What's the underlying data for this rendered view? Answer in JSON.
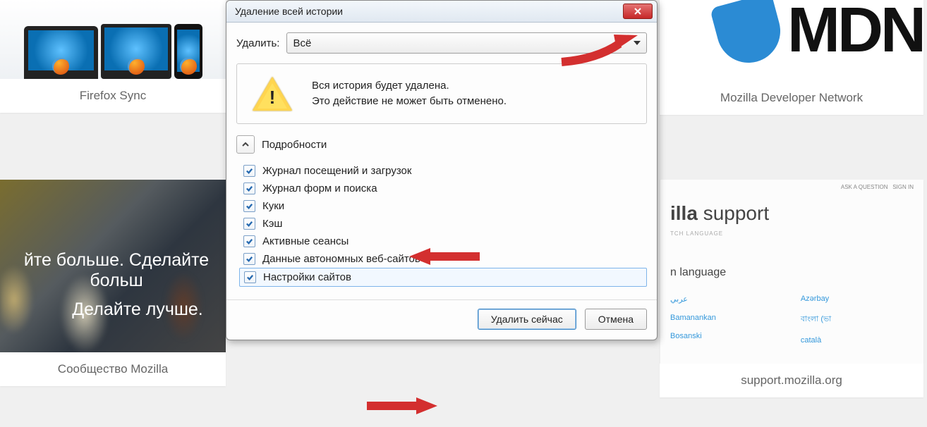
{
  "background": {
    "tile1_label": "Firefox Sync",
    "tile2_label": "Mozilla Developer Network",
    "tile3_label": "Сообщество Mozilla",
    "tile4_label": "support.mozilla.org",
    "crowd_line1": "йте больше. Сделайте больш",
    "crowd_line2": "Делайте лучше.",
    "support_title_bold": "illa",
    "support_title_rest": " support",
    "switch_lang": "n language",
    "lang1": "عربي",
    "lang1_r": "Azərbay",
    "lang2": "Bamanankan",
    "lang2_r": "বাংলা (ভা",
    "lang3": "Bosanski",
    "lang3_r": "català",
    "mdn_text": "MDN",
    "top_nav1": "ASK A QUESTION",
    "top_nav2": "SIGN IN"
  },
  "dialog": {
    "title": "Удаление всей истории",
    "delete_label": "Удалить:",
    "delete_value": "Всё",
    "warning_line1": "Вся история будет удалена.",
    "warning_line2": "Это действие не может быть отменено.",
    "details_label": "Подробности",
    "checks": [
      "Журнал посещений и загрузок",
      "Журнал форм и поиска",
      "Куки",
      "Кэш",
      "Активные сеансы",
      "Данные автономных веб-сайтов",
      "Настройки сайтов"
    ],
    "btn_clear": "Удалить сейчас",
    "btn_cancel": "Отмена"
  }
}
